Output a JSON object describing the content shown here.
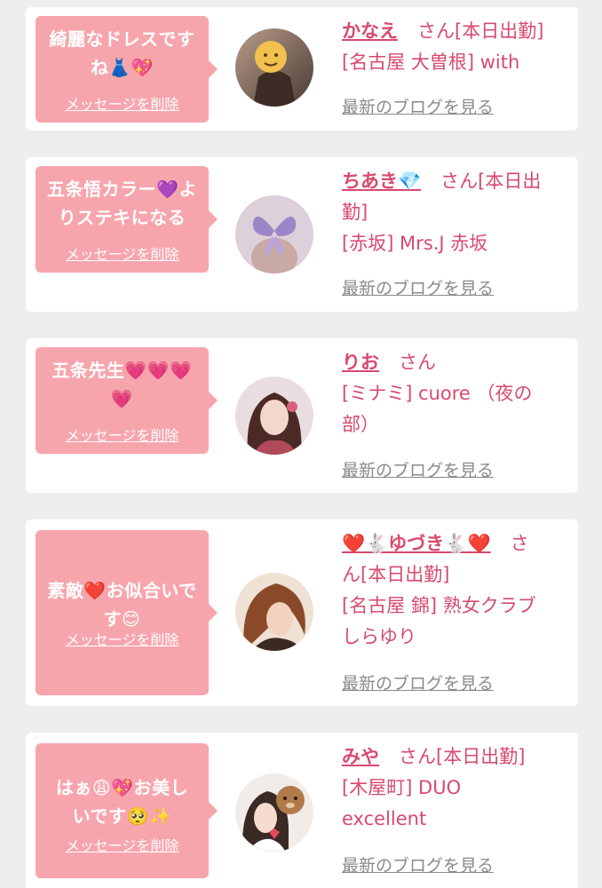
{
  "messages": [
    {
      "bubble_lines": [
        "綺麗なドレスです",
        "ね👗💖"
      ],
      "delete_label": "メッセージを削除",
      "name": "かなえ",
      "suffix": "さん[本日出勤]",
      "shop_lines": [
        "[名古屋 大曽根] with"
      ],
      "blog_label": "最新のブログを見る"
    },
    {
      "bubble_lines": [
        "五条悟カラー💜よ",
        "りステキになる"
      ],
      "delete_label": "メッセージを削除",
      "name": "ちあき💎",
      "suffix": "さん[本日出",
      "shop_lines": [
        "勤]",
        "[赤坂] Mrs.J 赤坂"
      ],
      "blog_label": "最新のブログを見る"
    },
    {
      "bubble_lines": [
        "五条先生💗💗💗",
        "💗"
      ],
      "delete_label": "メッセージを削除",
      "name": "りお",
      "suffix": "さん",
      "shop_lines": [
        "[ミナミ] cuore （夜の",
        "部）"
      ],
      "blog_label": "最新のブログを見る"
    },
    {
      "bubble_lines": [
        "素敵❤️お似合いで",
        "す😊"
      ],
      "delete_label": "メッセージを削除",
      "name": "❤️🐇ゆづき🐇❤️",
      "suffix": "さ",
      "shop_lines": [
        "ん[本日出勤]",
        "[名古屋 錦] 熟女クラブ",
        "しらゆり"
      ],
      "blog_label": "最新のブログを見る"
    },
    {
      "bubble_lines": [
        "はぁ😩💖お美し",
        "いです🥺✨"
      ],
      "delete_label": "メッセージを削除",
      "name": "みや",
      "suffix": "さん[本日出勤]",
      "shop_lines": [
        "[木屋町] DUO",
        "excellent"
      ],
      "blog_label": "最新のブログを見る"
    }
  ],
  "colors": {
    "background": "#f0edef",
    "bubble": "#f7a5ad",
    "name": "#d84a6e",
    "link_gray": "#8a8a8a"
  }
}
